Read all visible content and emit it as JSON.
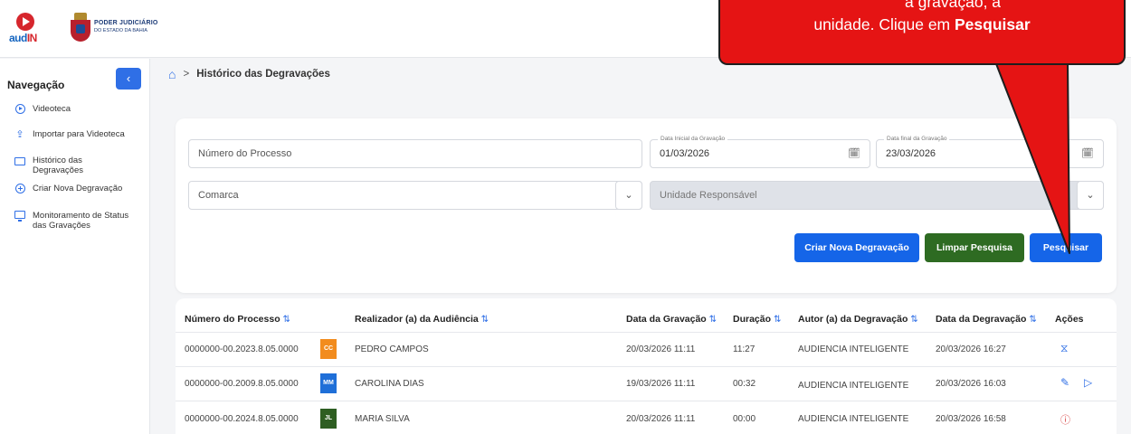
{
  "header": {
    "logo_text_a": "aud",
    "logo_text_b": "IN",
    "court_line1": "PODER JUDICIÁRIO",
    "court_line2": "DO ESTADO DA BAHIA"
  },
  "sidebar": {
    "title": "Navegação",
    "collapse_label": "‹",
    "items": [
      {
        "label": "Videoteca",
        "icon": "play-circle-icon"
      },
      {
        "label": "Importar para Videoteca",
        "icon": "upload-icon"
      },
      {
        "label": "Histórico das Degravações",
        "icon": "folder-icon"
      },
      {
        "label": "Criar Nova Degravação",
        "icon": "plus-circle-icon"
      },
      {
        "label": "Monitoramento de Status das Gravações",
        "icon": "monitor-icon"
      }
    ]
  },
  "breadcrumb": {
    "home_icon": "⌂",
    "separator": ">",
    "current": "Histórico das Degravações"
  },
  "filters": {
    "process_placeholder": "Número do Processo",
    "start_label": "Data Inicial da Gravação",
    "start_value": "01/03/2026",
    "end_label": "Data final da Gravação",
    "end_value": "23/03/2026",
    "comarca_placeholder": "Comarca",
    "unidade_placeholder": "Unidade Responsável",
    "calendar_glyph": "🗓",
    "chevron_glyph": "⌄",
    "create_button": "Criar Nova Degravação",
    "clear_button": "Limpar Pesquisa",
    "search_button": "Pesquisar"
  },
  "table": {
    "sort_glyph": "⇅",
    "headers": {
      "process": "Número do Processo",
      "realizer": "Realizador (a) da Audiência",
      "recording_date": "Data da Gravação",
      "duration": "Duração",
      "author": "Autor (a) da Degravação",
      "degravacao_date": "Data da Degravação",
      "actions": "Ações"
    },
    "rows": [
      {
        "process": "0000000-00.2023.8.05.0000",
        "initials": "CC",
        "badge_color": "#f28c1e",
        "realizer": "PEDRO CAMPOS",
        "recording_date": "20/03/2026 11:11",
        "duration": "11:27",
        "author": "AUDIENCIA INTELIGENTE",
        "degravacao_date": "20/03/2026 16:27",
        "actions": [
          "⧖"
        ]
      },
      {
        "process": "0000000-00.2009.8.05.0000",
        "initials": "MM",
        "badge_color": "#1f6fd8",
        "realizer": "CAROLINA DIAS",
        "recording_date": "19/03/2026 11:11",
        "duration": "00:32",
        "author": "AUDIENCIA INTELIGENTE",
        "degravacao_date": "20/03/2026 16:03",
        "actions": [
          "✎",
          "▷"
        ]
      },
      {
        "process": "0000000-00.2024.8.05.0000",
        "initials": "JL",
        "badge_color": "#2e5e22",
        "realizer": "MARIA SILVA",
        "recording_date": "20/03/2026 11:11",
        "duration": "00:00",
        "author": "AUDIENCIA INTELIGENTE",
        "degravacao_date": "20/03/2026 16:58",
        "actions": [
          "ⓘ"
        ]
      }
    ]
  },
  "callout": {
    "line1_partial": "a gravação, a",
    "line2_prefix": "unidade. Clique em ",
    "line2_bold": "Pesquisar",
    "color": "#e51414"
  }
}
